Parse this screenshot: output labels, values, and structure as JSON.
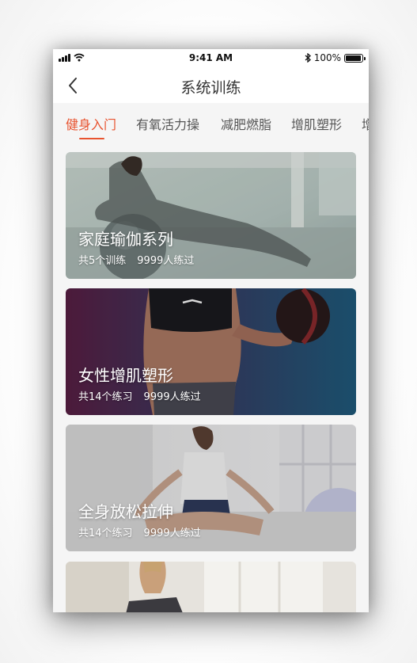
{
  "status_bar": {
    "time": "9:41 AM",
    "battery_text": "100%",
    "battery_level": 1.0,
    "icons": [
      "signal-icon",
      "wifi-icon",
      "bluetooth-icon",
      "battery-icon"
    ]
  },
  "nav": {
    "title": "系统训练",
    "back_icon": "chevron-left-icon"
  },
  "tabs": [
    {
      "label": "健身入门",
      "active": true
    },
    {
      "label": "有氧活力操",
      "active": false
    },
    {
      "label": "减肥燃脂",
      "active": false
    },
    {
      "label": "增肌塑形",
      "active": false
    },
    {
      "label": "增",
      "active": false
    }
  ],
  "colors": {
    "accent": "#e8532f",
    "background": "#f5f5f5",
    "text_primary": "#333333",
    "text_secondary": "#555555"
  },
  "cards": [
    {
      "title": "家庭瑜伽系列",
      "count": "共5个训练",
      "participants": "9999人练过"
    },
    {
      "title": "女性增肌塑形",
      "count": "共14个练习",
      "participants": "9999人练过"
    },
    {
      "title": "全身放松拉伸",
      "count": "共14个练习",
      "participants": "9999人练过"
    },
    {
      "title": "",
      "count": "",
      "participants": ""
    }
  ]
}
